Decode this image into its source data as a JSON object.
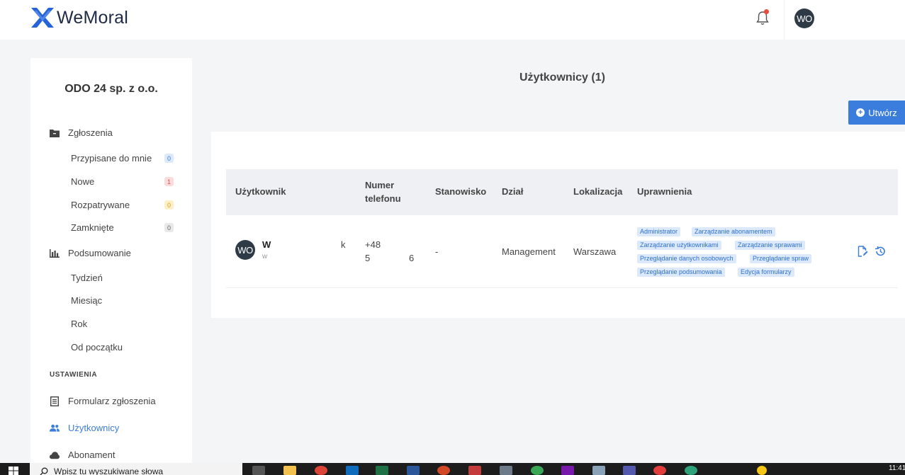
{
  "app": {
    "name": "WeMoral"
  },
  "header": {
    "avatar_initials": "WO"
  },
  "sidebar": {
    "company": "ODO 24 sp. z o.o.",
    "groups": [
      {
        "label": "Zgłoszenia",
        "icon": "folder-icon"
      },
      {
        "label": "Podsumowanie",
        "icon": "bar-chart-icon"
      }
    ],
    "tickets": [
      {
        "label": "Przypisane do mnie",
        "count": "0",
        "badge_color": "#dbe9fb"
      },
      {
        "label": "Nowe",
        "count": "1",
        "badge_color": "#fbdcdc"
      },
      {
        "label": "Rozpatrywane",
        "count": "0",
        "badge_color": "#fdf0c8"
      },
      {
        "label": "Zamknięte",
        "count": "0",
        "badge_color": "#e9e9e9"
      }
    ],
    "summary": [
      "Tydzień",
      "Miesiąc",
      "Rok",
      "Od początku"
    ],
    "settings_label": "USTAWIENIA",
    "settings": [
      {
        "label": "Formularz zgłoszenia",
        "icon": "form-icon"
      },
      {
        "label": "Użytkownicy",
        "icon": "users-icon",
        "active": true
      },
      {
        "label": "Abonament",
        "icon": "cloud-icon"
      }
    ]
  },
  "main": {
    "title": "Użytkownicy (1)",
    "create_label": "Utwórz",
    "columns": [
      "Użytkownik",
      "Numer",
      "telefonu",
      "Stanowisko",
      "Dział",
      "Lokalizacja",
      "Uprawnienia"
    ],
    "row": {
      "avatar": "WO",
      "name_start": "W",
      "name_end": "k",
      "email_start": "w",
      "phone_line1": "+48",
      "phone_line2_start": "5",
      "phone_line2_end": "6",
      "position": "-",
      "department": "Management",
      "location": "Warszawa",
      "permissions": [
        "Administrator",
        "Zarządzanie abonamentem",
        "Zarządzanie użytkownikami",
        "Zarządzanie sprawami",
        "Przeglądanie danych osobowych",
        "Przeglądanie spraw",
        "Przeglądanie podsumowania",
        "Edycja formularzy"
      ]
    }
  },
  "taskbar": {
    "search_placeholder": "Wpisz tu wyszukiwane słowa",
    "time": "11:41"
  },
  "colors": {
    "accent": "#3b7ddd",
    "avatar": "#2f3a47",
    "logo": "#2563d9"
  }
}
